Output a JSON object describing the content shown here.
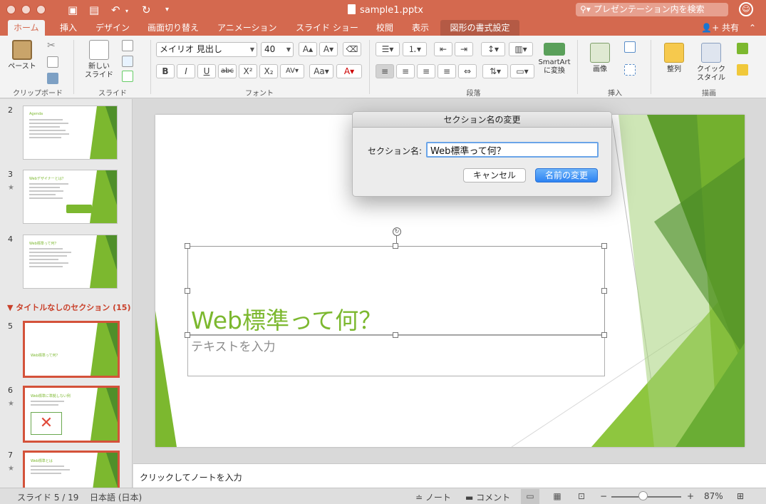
{
  "titlebar": {
    "document_title": "sample1.pptx",
    "search_placeholder": "プレゼンテーション内を検索"
  },
  "tabs": [
    {
      "label": "ホーム",
      "active": true
    },
    {
      "label": "挿入"
    },
    {
      "label": "デザイン"
    },
    {
      "label": "画面切り替え"
    },
    {
      "label": "アニメーション"
    },
    {
      "label": "スライド ショー"
    },
    {
      "label": "校閲"
    },
    {
      "label": "表示"
    },
    {
      "label": "図形の書式設定",
      "contextual": true
    }
  ],
  "share_label": "共有",
  "ribbon": {
    "paste_label": "ペースト",
    "clipboard_group": "クリップボード",
    "new_slide_label_1": "新しい",
    "new_slide_label_2": "スライド",
    "slide_group": "スライド",
    "font_name": "メイリオ 見出し",
    "font_size": "40",
    "font_group": "フォント",
    "smartart_label_1": "SmartArt",
    "smartart_label_2": "に変換",
    "paragraph_group": "段落",
    "image_label": "画像",
    "insert_group": "挿入",
    "arrange_label": "整列",
    "quickstyle_label_1": "クイック",
    "quickstyle_label_2": "スタイル",
    "drawing_group": "描画",
    "bold": "B",
    "italic": "I",
    "underline": "U",
    "strike": "abc",
    "superscript": "X²",
    "subscript": "X₂"
  },
  "thumbnails": {
    "section_header": "タイトルなしのセクション (15)",
    "slides": [
      {
        "number": "2",
        "title": "Agenda",
        "starred": false
      },
      {
        "number": "3",
        "title": "Webデザイナーとは？",
        "starred": true
      },
      {
        "number": "4",
        "title": "Web標準って何？",
        "starred": false
      },
      {
        "number": "5",
        "title": "Web標準って何？",
        "starred": false,
        "selected": true
      },
      {
        "number": "6",
        "title": "Web標準に準拠しない例",
        "starred": true,
        "selected": true
      },
      {
        "number": "7",
        "title": "Web標準とは",
        "starred": true,
        "selected": true
      }
    ]
  },
  "slide": {
    "title": "Web標準って何？",
    "subtitle": "テキストを入力"
  },
  "notes_placeholder": "クリックしてノートを入力",
  "statusbar": {
    "slide_counter": "スライド 5 / 19",
    "language": "日本語 (日本)",
    "notes_label": "ノート",
    "comments_label": "コメント",
    "zoom": "87%",
    "zoom_fraction": 0.4
  },
  "dialog": {
    "title": "セクション名の変更",
    "field_label": "セクション名:",
    "field_value": "Web標準って何？",
    "cancel_label": "キャンセル",
    "ok_label": "名前の変更"
  },
  "colors": {
    "accent": "#d4694f",
    "slide_green": "#7cb82f",
    "primary_button": "#2d83f2"
  }
}
